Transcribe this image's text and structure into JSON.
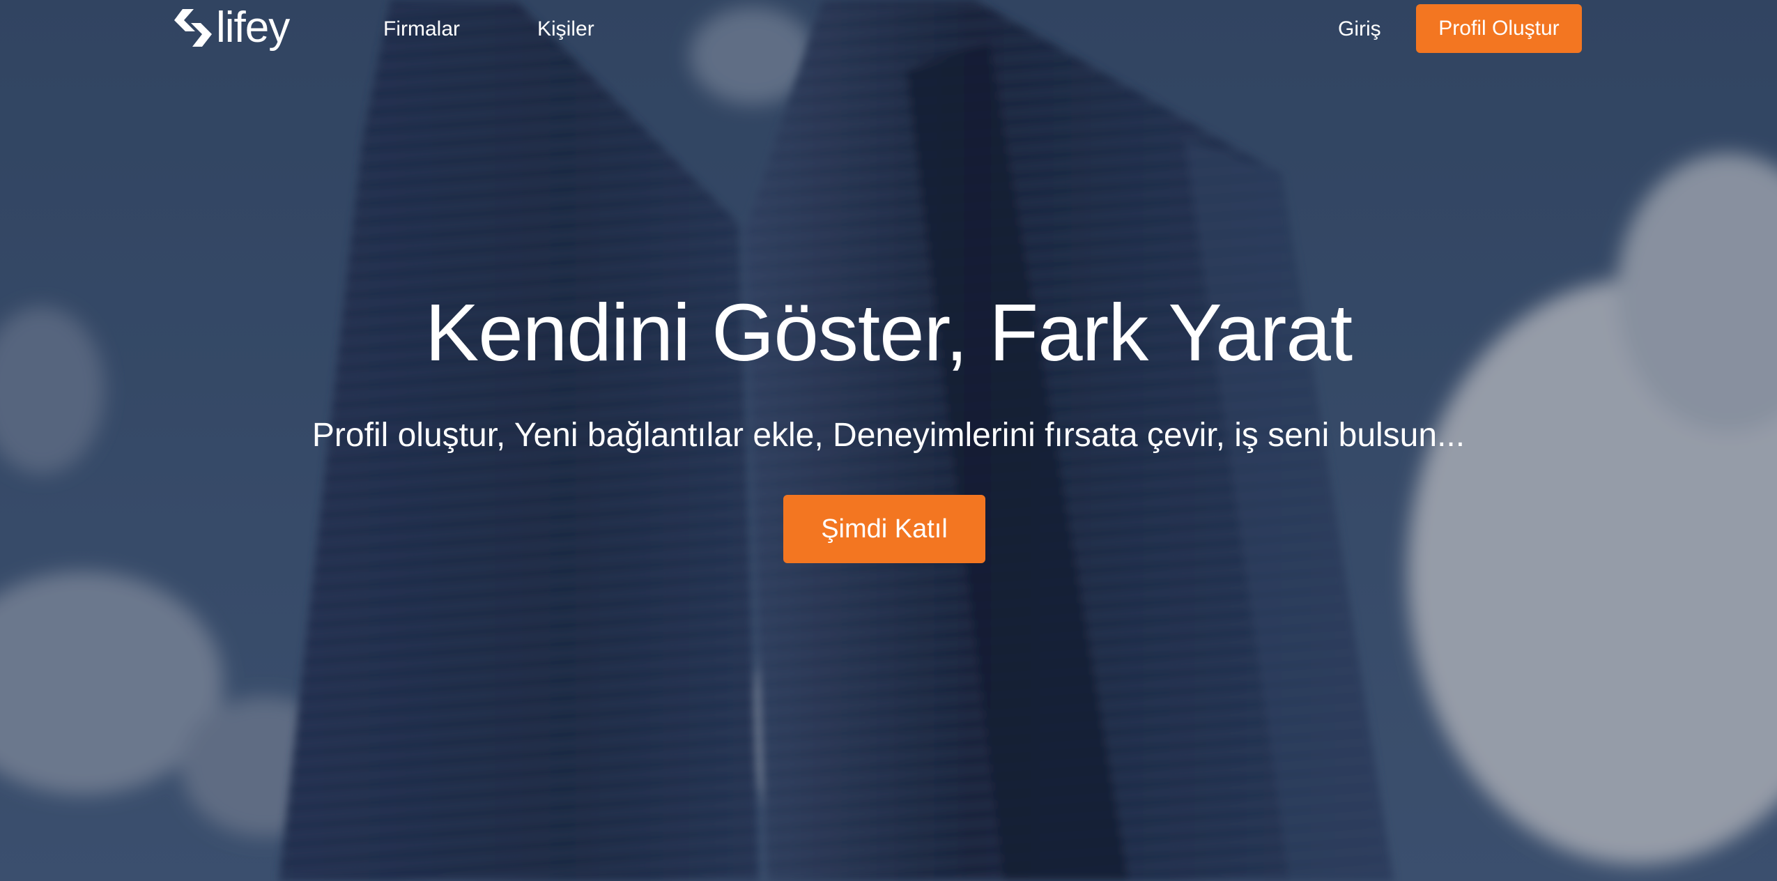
{
  "brand": {
    "logo_icon": "lifey-chevron-logo-icon",
    "name": "lifey"
  },
  "nav": {
    "links": [
      {
        "label": "Firmalar"
      },
      {
        "label": "Kişiler"
      }
    ],
    "login_label": "Giriş",
    "create_profile_label": "Profil Oluştur"
  },
  "hero": {
    "title": "Kendini Göster, Fark Yarat",
    "subtitle": "Profil oluştur, Yeni bağlantılar ekle, Deneyimlerini fırsata çevir, iş seni bulsun...",
    "cta_label": "Şimdi Katıl"
  },
  "colors": {
    "accent": "#f37621",
    "text": "#ffffff",
    "sky": "#3e5677"
  }
}
